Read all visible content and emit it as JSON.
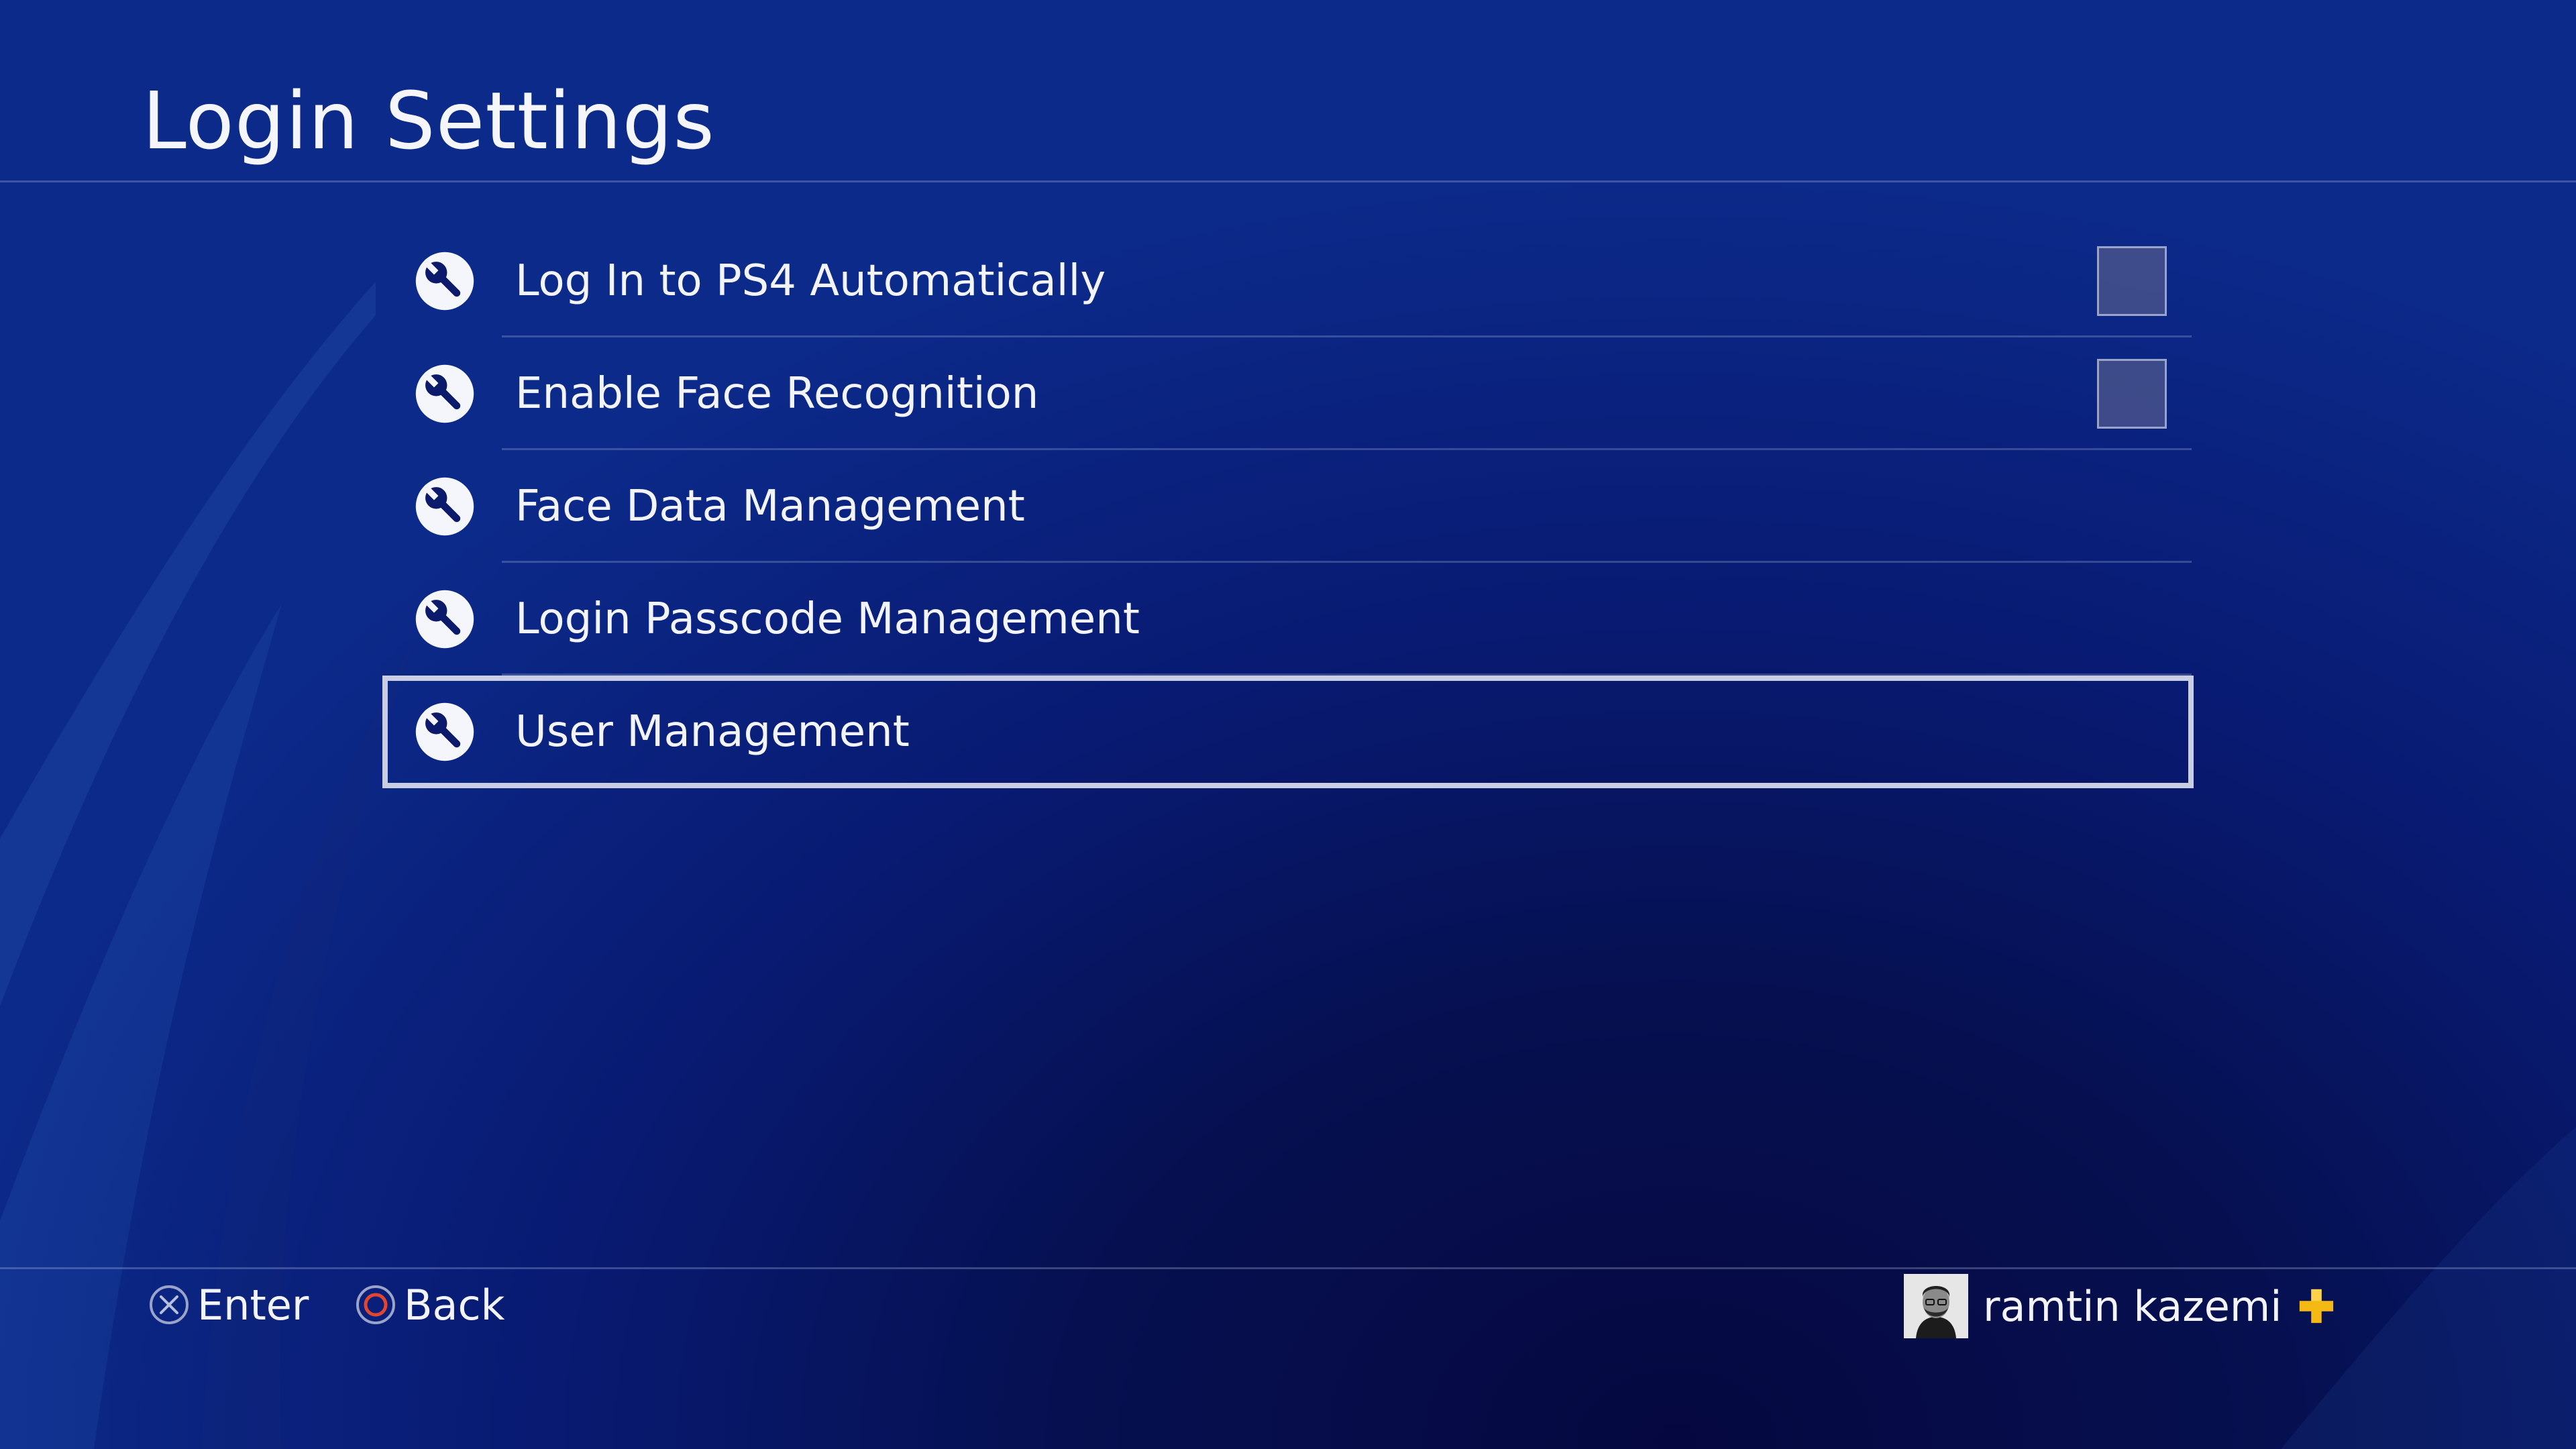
{
  "header": {
    "title": "Login Settings"
  },
  "menu": {
    "items": [
      {
        "label": "Log In to PS4 Automatically",
        "icon": "wrench-icon",
        "control": "checkbox",
        "checked": false
      },
      {
        "label": "Enable Face Recognition",
        "icon": "wrench-icon",
        "control": "checkbox",
        "checked": false
      },
      {
        "label": "Face Data Management",
        "icon": "wrench-icon"
      },
      {
        "label": "Login Passcode Management",
        "icon": "wrench-icon"
      },
      {
        "label": "User Management",
        "icon": "wrench-icon",
        "selected": true
      }
    ]
  },
  "footer": {
    "enter_label": "Enter",
    "enter_icon": "cross-button-icon",
    "back_label": "Back",
    "back_icon": "circle-button-icon",
    "user_name": "ramtin kazemi",
    "user_badge": "ps-plus-icon"
  },
  "colors": {
    "background": "#081a72",
    "selection_outline": "#c9cee3",
    "ps_plus": "#f5b914",
    "circle_button": "#e2462e"
  }
}
